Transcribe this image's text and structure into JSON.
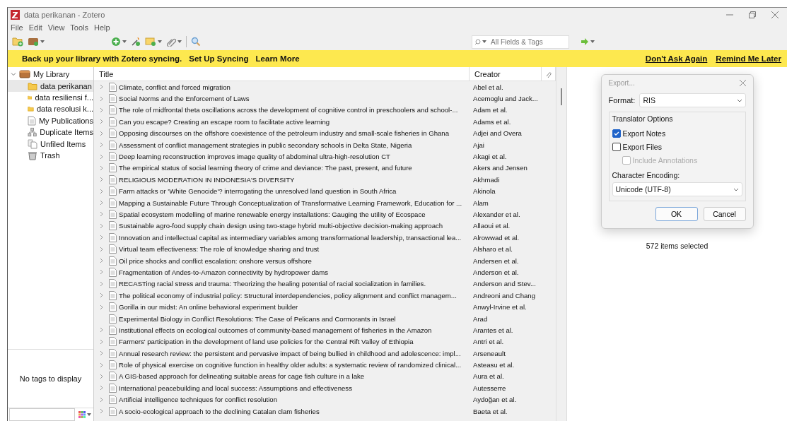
{
  "window": {
    "title": "data perikanan - Zotero"
  },
  "menu": [
    "File",
    "Edit",
    "View",
    "Tools",
    "Help"
  ],
  "search": {
    "placeholder": "All Fields & Tags"
  },
  "sync_banner": {
    "message": "Back up your library with Zotero syncing.",
    "links": [
      "Set Up Syncing",
      "Learn More"
    ],
    "actions": [
      "Don't Ask Again",
      "Remind Me Later"
    ]
  },
  "sidebar": {
    "items": [
      {
        "label": "My Library",
        "kind": "library",
        "selected": false,
        "expanded": true,
        "children": [
          {
            "label": "data perikanan",
            "kind": "folder",
            "selected": true
          },
          {
            "label": "data resiliensi f...",
            "kind": "folder",
            "selected": false
          },
          {
            "label": "data resolusi k...",
            "kind": "folder",
            "selected": false
          },
          {
            "label": "My Publications",
            "kind": "publications",
            "selected": false
          },
          {
            "label": "Duplicate Items",
            "kind": "duplicates",
            "selected": false
          },
          {
            "label": "Unfiled Items",
            "kind": "unfiled",
            "selected": false
          },
          {
            "label": "Trash",
            "kind": "trash",
            "selected": false
          }
        ]
      }
    ],
    "tags_message": "No tags to display"
  },
  "table": {
    "columns": [
      "Title",
      "Creator"
    ],
    "rows": [
      {
        "title": "Climate, conflict and forced migration",
        "creator": "Abel et al.",
        "expandable": true
      },
      {
        "title": "Social Norms and the Enforcement of Laws",
        "creator": "Acemoglu and Jack...",
        "expandable": true
      },
      {
        "title": "The role of midfrontal theta oscillations across the development of cognitive control in preschoolers and school-...",
        "creator": "Adam et al.",
        "expandable": true
      },
      {
        "title": "Can you escape? Creating an escape room to facilitate active learning",
        "creator": "Adams et al.",
        "expandable": true
      },
      {
        "title": "Opposing discourses on the offshore coexistence of the petroleum industry and small-scale fisheries in Ghana",
        "creator": "Adjei and Overa",
        "expandable": true
      },
      {
        "title": "Assessment of conflict management strategies in public secondary schools in Delta State, Nigeria",
        "creator": "Ajai",
        "expandable": true
      },
      {
        "title": "Deep learning reconstruction improves image quality of abdominal ultra-high-resolution CT",
        "creator": "Akagi et al.",
        "expandable": true
      },
      {
        "title": "The empirical status of social learning theory of crime and deviance: The past, present, and future",
        "creator": "Akers and Jensen",
        "expandable": true
      },
      {
        "title": "RELIGIOUS MODERATION IN INDONESIA'S DIVERSITY",
        "creator": "Akhmadi",
        "expandable": true
      },
      {
        "title": "Farm attacks or 'White Genocide'? interrogating the unresolved land question in South Africa",
        "creator": "Akinola",
        "expandable": true
      },
      {
        "title": "Mapping a Sustainable Future Through Conceptualization of Transformative Learning Framework, Education for ...",
        "creator": "Alam",
        "expandable": true
      },
      {
        "title": "Spatial ecosystem modelling of marine renewable energy installations: Gauging the utility of Ecospace",
        "creator": "Alexander et al.",
        "expandable": true
      },
      {
        "title": "Sustainable agro-food supply chain design using two-stage hybrid multi-objective decision-making approach",
        "creator": "Allaoui et al.",
        "expandable": true
      },
      {
        "title": "Innovation and intellectual capital as intermediary variables among transformational leadership, transactional lea...",
        "creator": "Alrowwad et al.",
        "expandable": true
      },
      {
        "title": "Virtual team effectiveness: The role of knowledge sharing and trust",
        "creator": "Alsharo et al.",
        "expandable": true
      },
      {
        "title": "Oil price shocks and conflict escalation: onshore versus offshore",
        "creator": "Andersen et al.",
        "expandable": true
      },
      {
        "title": "Fragmentation of Andes-to-Amazon connectivity by hydropower dams",
        "creator": "Anderson et al.",
        "expandable": true
      },
      {
        "title": "RECASTing racial stress and trauma: Theorizing the healing potential of racial socialization in families.",
        "creator": "Anderson and Stev...",
        "expandable": true
      },
      {
        "title": "The political economy of industrial policy: Structural interdependencies, policy alignment and conflict managem...",
        "creator": "Andreoni and Chang",
        "expandable": true
      },
      {
        "title": "Gorilla in our midst: An online behavioral experiment builder",
        "creator": "Anwyl-Irvine et al.",
        "expandable": true
      },
      {
        "title": "Experimental Biology in Conflict Resolutions: The Case of Pelicans and Cormorants in Israel",
        "creator": "Arad",
        "expandable": false
      },
      {
        "title": "Institutional effects on ecological outcomes of community-based management of fisheries in the Amazon",
        "creator": "Arantes et al.",
        "expandable": true
      },
      {
        "title": "Farmers' participation in the development of land use policies for the Central Rift Valley of Ethiopia",
        "creator": "Antri et al.",
        "expandable": true
      },
      {
        "title": "Annual research review: the persistent and pervasive impact of being bullied in childhood and adolescence: impl...",
        "creator": "Arseneault",
        "expandable": true
      },
      {
        "title": "Role of physical exercise on cognitive function in healthy older adults: a systematic review of randomized clinical...",
        "creator": "Asteasu et al.",
        "expandable": true
      },
      {
        "title": "A GIS-based approach for delineating suitable areas for cage fish culture in a lake",
        "creator": "Aura et al.",
        "expandable": true
      },
      {
        "title": "International peacebuilding and local success: Assumptions and effectiveness",
        "creator": "Autesserre",
        "expandable": true
      },
      {
        "title": "Artificial intelligence techniques for conflict resolution",
        "creator": "Aydoğan et al.",
        "expandable": true
      },
      {
        "title": "A socio-ecological approach to the declining Catalan clam fisheries",
        "creator": "Baeta et al.",
        "expandable": true
      }
    ]
  },
  "selection_status": "572 items selected",
  "dialog": {
    "title": "Export...",
    "format_label": "Format:",
    "format_value": "RIS",
    "group_label": "Translator Options",
    "options": [
      {
        "label": "Export Notes",
        "checked": true,
        "disabled": false,
        "nested": false
      },
      {
        "label": "Export Files",
        "checked": false,
        "disabled": false,
        "nested": false
      },
      {
        "label": "Include Annotations",
        "checked": false,
        "disabled": true,
        "nested": true
      }
    ],
    "encoding_label": "Character Encoding:",
    "encoding_value": "Unicode (UTF-8)",
    "buttons": [
      {
        "label": "OK",
        "default": true
      },
      {
        "label": "Cancel",
        "default": false
      }
    ]
  }
}
